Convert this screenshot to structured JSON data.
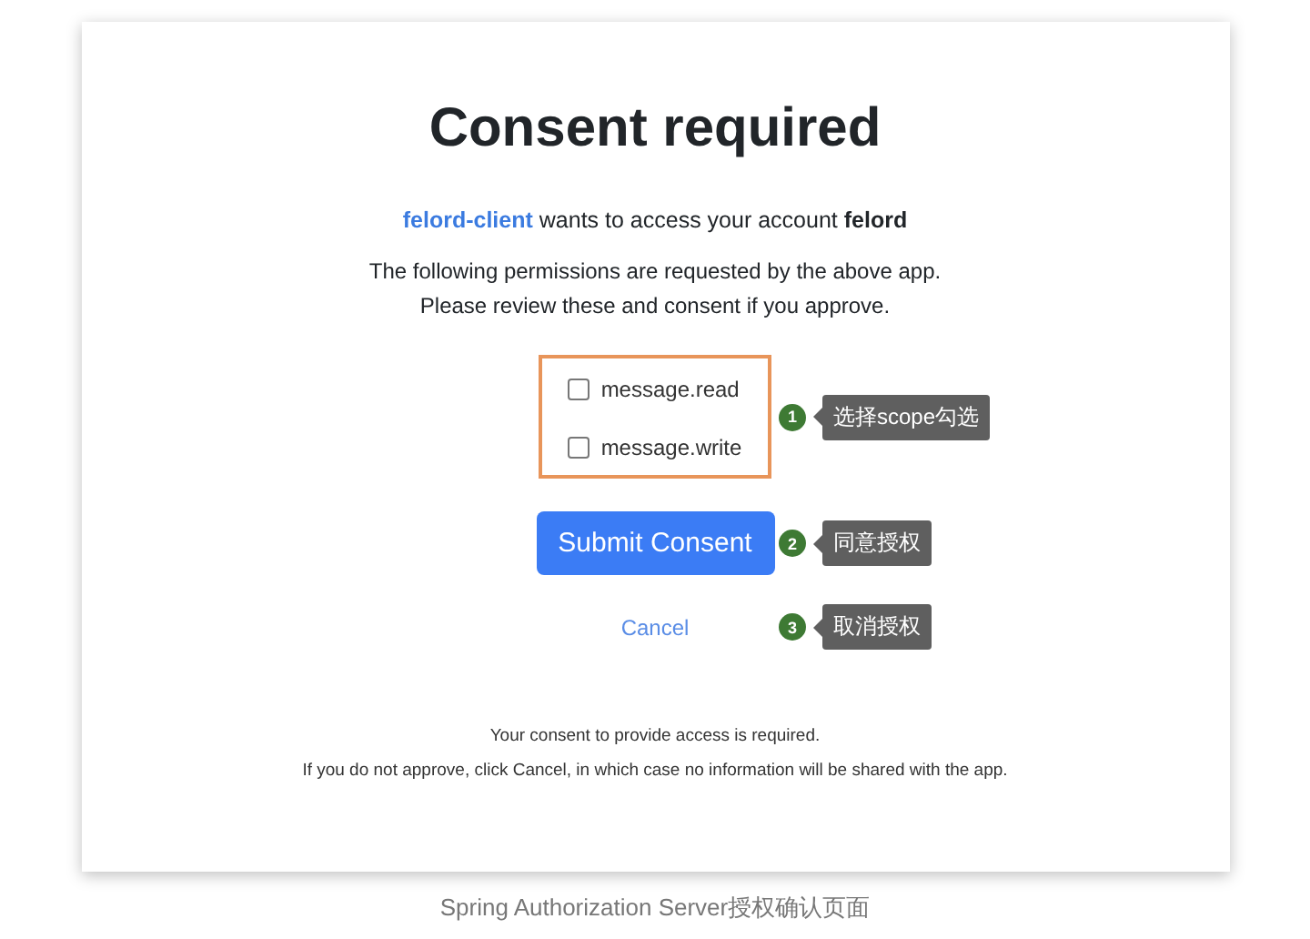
{
  "title": "Consent required",
  "request": {
    "client": "felord-client",
    "middle": "wants to access your account",
    "account": "felord"
  },
  "permissions_text": [
    "The following permissions are requested by the above app.",
    "Please review these and consent if you approve."
  ],
  "scopes": [
    {
      "label": "message.read",
      "checked": false
    },
    {
      "label": "message.write",
      "checked": false
    }
  ],
  "submit_button": "Submit Consent",
  "cancel_link": "Cancel",
  "annotations": [
    {
      "number": "1",
      "text": "选择scope勾选"
    },
    {
      "number": "2",
      "text": "同意授权"
    },
    {
      "number": "3",
      "text": "取消授权"
    }
  ],
  "footer": [
    "Your consent to provide access is required.",
    "If you do not approve, click Cancel, in which case no information will be shared with the app."
  ],
  "caption": "Spring Authorization Server授权确认页面"
}
